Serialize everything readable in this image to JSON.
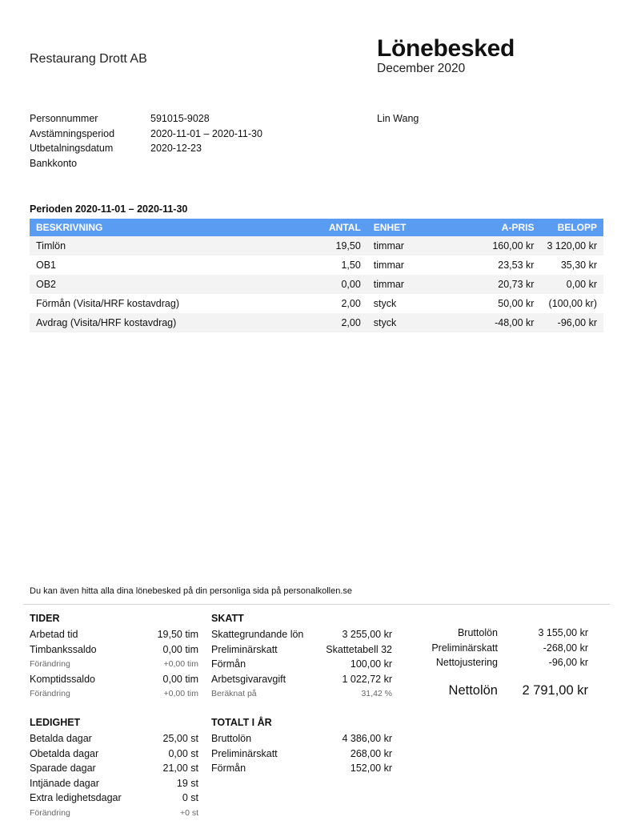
{
  "header": {
    "company": "Restaurang Drott AB",
    "title": "Lönebesked",
    "subtitle": "December 2020"
  },
  "info": [
    {
      "label": "Personnummer",
      "value": "591015-9028"
    },
    {
      "label": "Avstämningsperiod",
      "value": "2020-11-01 – 2020-11-30"
    },
    {
      "label": "Utbetalningsdatum",
      "value": "2020-12-23"
    },
    {
      "label": "Bankkonto",
      "value": ""
    }
  ],
  "employee": {
    "name": "Lin Wang"
  },
  "period": {
    "heading": "Perioden 2020-11-01 – 2020-11-30",
    "columns": {
      "desc": "Beskrivning",
      "qty": "Antal",
      "unit": "Enhet",
      "price": "A-pris",
      "amount": "Belopp"
    },
    "rows": [
      {
        "desc": "Timlön",
        "qty": "19,50",
        "unit": "timmar",
        "price": "160,00 kr",
        "amount": "3 120,00 kr"
      },
      {
        "desc": "OB1",
        "qty": "1,50",
        "unit": "timmar",
        "price": "23,53 kr",
        "amount": "35,30 kr"
      },
      {
        "desc": "OB2",
        "qty": "0,00",
        "unit": "timmar",
        "price": "20,73 kr",
        "amount": "0,00 kr"
      },
      {
        "desc": "Förmån (Visita/HRF kostavdrag)",
        "qty": "2,00",
        "unit": "styck",
        "price": "50,00 kr",
        "amount": "(100,00 kr)"
      },
      {
        "desc": "Avdrag (Visita/HRF kostavdrag)",
        "qty": "2,00",
        "unit": "styck",
        "price": "-48,00 kr",
        "amount": "-96,00 kr"
      }
    ]
  },
  "footnote": "Du kan även hitta alla dina lönebesked på din personliga sida på personalkollen.se",
  "tider": {
    "title": "TIDER",
    "rows": [
      {
        "label": "Arbetad tid",
        "value": "19,50 tim"
      },
      {
        "label": "Timbankssaldo",
        "value": "0,00 tim"
      },
      {
        "label": "Förändring",
        "value": "+0,00 tim"
      },
      {
        "label": "Komptidssaldo",
        "value": "0,00 tim"
      },
      {
        "label": "Förändring",
        "value": "+0,00 tim"
      }
    ]
  },
  "skatt": {
    "title": "SKATT",
    "rows": [
      {
        "label": "Skattegrundande lön",
        "value": "3 255,00 kr"
      },
      {
        "label": "Preliminärskatt",
        "value": "Skattetabell 32"
      },
      {
        "label": "Förmån",
        "value": "100,00 kr"
      },
      {
        "label": "Arbetsgivaravgift",
        "value": "1 022,72 kr"
      },
      {
        "label": "Beräknat på",
        "value": "31,42 %"
      }
    ]
  },
  "ledighet": {
    "title": "LEDIGHET",
    "rows": [
      {
        "label": "Betalda dagar",
        "value": "25,00 st"
      },
      {
        "label": "Obetalda dagar",
        "value": "0,00 st"
      },
      {
        "label": "Sparade dagar",
        "value": "21,00 st"
      },
      {
        "label": "Intjänade dagar",
        "value": "19 st"
      },
      {
        "label": "Extra ledighetsdagar",
        "value": "0 st"
      },
      {
        "label": "Förändring",
        "value": "+0 st"
      }
    ]
  },
  "totalt": {
    "title": "TOTALT I ÅR",
    "rows": [
      {
        "label": "Bruttolön",
        "value": "4 386,00 kr"
      },
      {
        "label": "Preliminärskatt",
        "value": "268,00 kr"
      },
      {
        "label": "Förmån",
        "value": "152,00 kr"
      }
    ]
  },
  "summary": {
    "rows": [
      {
        "label": "Bruttolön",
        "value": "3 155,00 kr"
      },
      {
        "label": "Preliminärskatt",
        "value": "-268,00 kr"
      },
      {
        "label": "Nettojustering",
        "value": "-96,00 kr"
      }
    ],
    "net_label": "Nettolön",
    "net_value": "2 791,00 kr"
  }
}
